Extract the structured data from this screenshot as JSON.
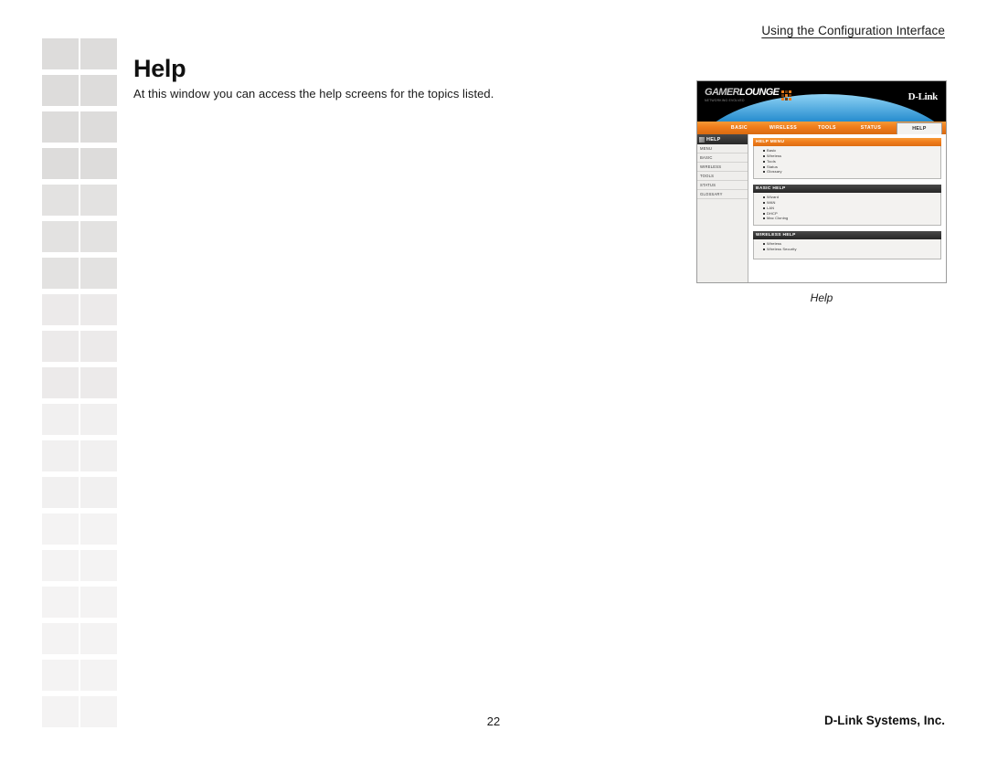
{
  "header": {
    "running_head": "Using the Configuration Interface"
  },
  "page": {
    "title": "Help",
    "intro": "At this window you can access the help screens for the topics listed."
  },
  "figure": {
    "caption": "Help",
    "router_ui": {
      "brand": {
        "logo_word_1": "GAMER",
        "logo_word_2": "LOUNGE",
        "logo_subtitle": "NETWORKING EVOLVED",
        "vendor": "D-Link"
      },
      "nav_tabs": [
        {
          "label": "BASIC",
          "active": false
        },
        {
          "label": "WIRELESS",
          "active": false
        },
        {
          "label": "TOOLS",
          "active": false
        },
        {
          "label": "STATUS",
          "active": false
        },
        {
          "label": "HELP",
          "active": true
        }
      ],
      "sidebar": {
        "title": "HELP",
        "items": [
          "MENU",
          "BASIC",
          "WIRELESS",
          "TOOLS",
          "STATUS",
          "GLOSSARY"
        ]
      },
      "panels": [
        {
          "title": "HELP MENU",
          "style": "orange",
          "items": [
            "Basic",
            "Wireless",
            "Tools",
            "Status",
            "Glossary"
          ]
        },
        {
          "title": "BASIC HELP",
          "style": "dark",
          "items": [
            "Wizard",
            "WAN",
            "LAN",
            "DHCP",
            "Mac Cloning"
          ]
        },
        {
          "title": "WIRELESS HELP",
          "style": "dark",
          "items": [
            "Wireless",
            "Wireless Security"
          ]
        }
      ]
    }
  },
  "footer": {
    "page_number": "22",
    "company": "D-Link Systems, Inc."
  },
  "colors": {
    "accent_orange": "#ef7c1b",
    "panel_dark": "#262626",
    "page_background": "#ffffff",
    "deco_block": "#dddcdb"
  }
}
